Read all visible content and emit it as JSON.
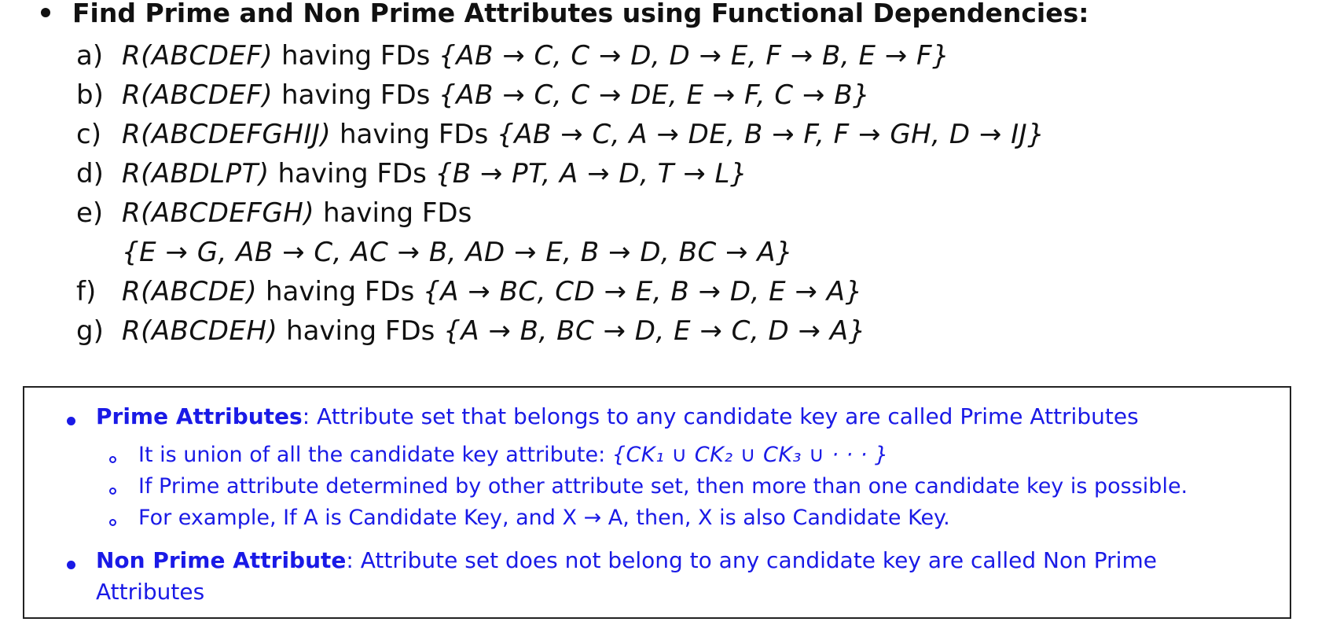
{
  "title": "Find Prime and Non Prime Attributes using Functional Dependencies:",
  "exercises": [
    {
      "label": "a)",
      "relation": "R(ABCDEF)",
      "having": "having FDs",
      "fds": "{AB → C, C → D, D → E, F → B, E → F}"
    },
    {
      "label": "b)",
      "relation": "R(ABCDEF)",
      "having": "having FDs",
      "fds": "{AB → C, C → DE, E → F, C → B}"
    },
    {
      "label": "c)",
      "relation": "R(ABCDEFGHIJ)",
      "having": "having FDs",
      "fds": "{AB → C, A → DE, B → F, F → GH, D → IJ}"
    },
    {
      "label": "d)",
      "relation": "R(ABDLPT)",
      "having": "having FDs",
      "fds": "{B → PT, A → D, T → L}"
    },
    {
      "label": "e)",
      "relation": "R(ABCDEFGH)",
      "having": "having FDs",
      "fds": ""
    },
    {
      "label": "",
      "relation": "",
      "having": "",
      "fds": "{E → G, AB → C, AC → B, AD → E, B → D, BC → A}"
    },
    {
      "label": "f)",
      "relation": "R(ABCDE)",
      "having": "having FDs",
      "fds": "{A → BC, CD → E, B → D, E → A}"
    },
    {
      "label": "g)",
      "relation": "R(ABCDEH)",
      "having": "having FDs",
      "fds": "{A → B, BC → D, E → C, D → A}"
    }
  ],
  "definitions": {
    "prime": {
      "term": "Prime Attributes",
      "text": ": Attribute set that belongs to any candidate key are called Prime Attributes",
      "points": [
        {
          "text": "It is union of all the candidate key attribute: ",
          "math": "{CK₁ ∪ CK₂ ∪ CK₃ ∪ · · · }"
        },
        {
          "text": "If Prime attribute determined by other attribute set, then more than one candidate key is possible.",
          "math": ""
        },
        {
          "text": "For example, If A is Candidate Key, and X → A, then, X is also Candidate Key.",
          "math": ""
        }
      ]
    },
    "non_prime": {
      "term": "Non Prime Attribute",
      "text": ":  Attribute set does not belong to any candidate key are called Non Prime",
      "continuation": "Attributes"
    }
  },
  "colors": {
    "text": "#111111",
    "definition_text": "#1a1ae6",
    "box_border": "#222222",
    "background": "#ffffff"
  }
}
